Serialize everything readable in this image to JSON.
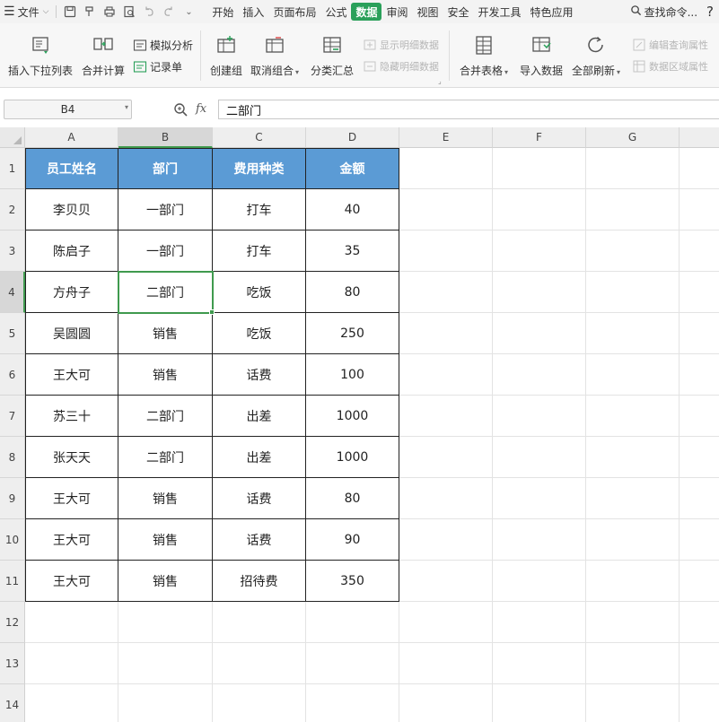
{
  "menu": {
    "file_label": "文件",
    "tabs": [
      "开始",
      "插入",
      "页面布局",
      "公式",
      "数据",
      "审阅",
      "视图",
      "安全",
      "开发工具",
      "特色应用"
    ],
    "active_tab": "数据",
    "search_label": "查找命令...",
    "help_label": "?"
  },
  "ribbon": {
    "insert_dropdown": "插入下拉列表",
    "merge_calc": "合并计算",
    "simulate_analysis": "模拟分析",
    "record_sheet": "记录单",
    "create_group": "创建组",
    "ungroup": "取消组合",
    "subtotal": "分类汇总",
    "show_detail": "显示明细数据",
    "hide_detail": "隐藏明细数据",
    "merge_tables": "合并表格",
    "import_data": "导入数据",
    "refresh_all": "全部刷新",
    "edit_query": "编辑查询属性",
    "data_range": "数据区域属性"
  },
  "formula_bar": {
    "name_box": "B4",
    "fx": "fx",
    "content": "二部门"
  },
  "grid": {
    "columns": [
      "A",
      "B",
      "C",
      "D",
      "E",
      "F",
      "G"
    ],
    "rows": [
      "1",
      "2",
      "3",
      "4",
      "5",
      "6",
      "7",
      "8",
      "9",
      "10",
      "11",
      "12",
      "13",
      "14"
    ],
    "selected_cell": "B4",
    "header": [
      "员工姓名",
      "部门",
      "费用种类",
      "金额"
    ],
    "data": [
      [
        "李贝贝",
        "一部门",
        "打车",
        "40"
      ],
      [
        "陈启子",
        "一部门",
        "打车",
        "35"
      ],
      [
        "方舟子",
        "二部门",
        "吃饭",
        "80"
      ],
      [
        "吴圆圆",
        "销售",
        "吃饭",
        "250"
      ],
      [
        "王大可",
        "销售",
        "话费",
        "100"
      ],
      [
        "苏三十",
        "二部门",
        "出差",
        "1000"
      ],
      [
        "张天天",
        "二部门",
        "出差",
        "1000"
      ],
      [
        "王大可",
        "销售",
        "话费",
        "80"
      ],
      [
        "王大可",
        "销售",
        "话费",
        "90"
      ],
      [
        "王大可",
        "销售",
        "招待费",
        "350"
      ]
    ],
    "colors": {
      "header_fill": "#5b9bd5",
      "selection": "#3f9a4e",
      "active_tab": "#2aa05a"
    }
  }
}
